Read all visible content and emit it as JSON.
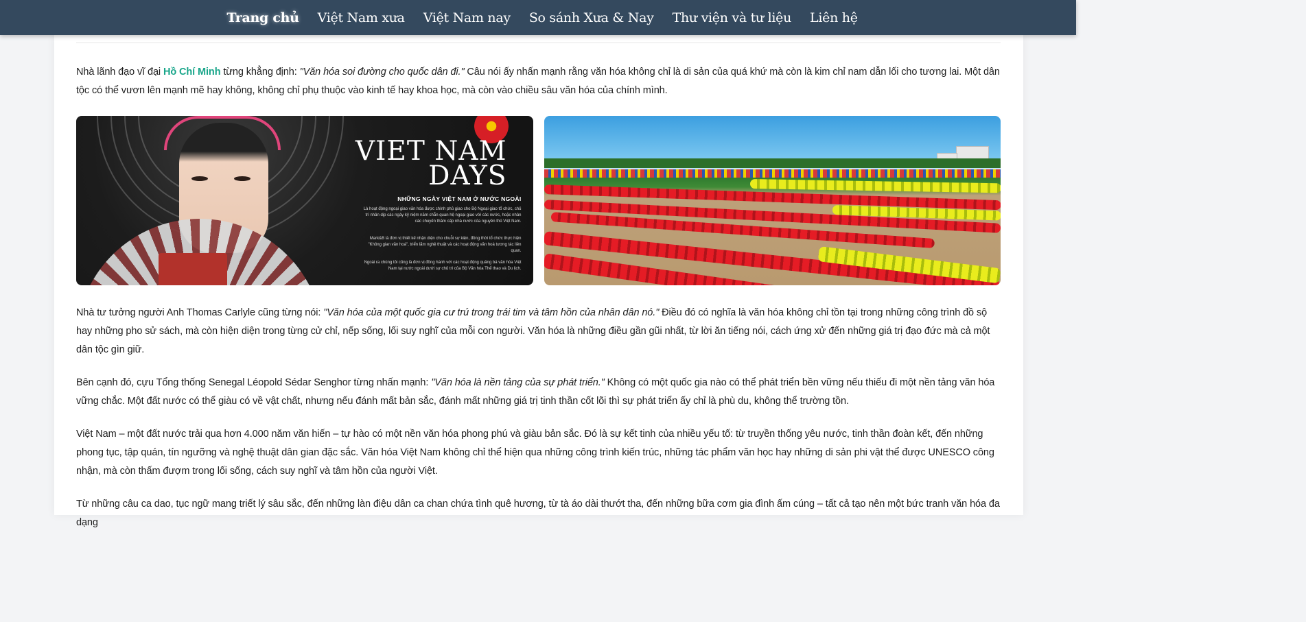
{
  "nav": {
    "items": [
      {
        "label": "Trang chủ",
        "active": true
      },
      {
        "label": "Việt Nam xưa",
        "active": false
      },
      {
        "label": "Việt Nam nay",
        "active": false
      },
      {
        "label": "So sánh Xưa & Nay",
        "active": false
      },
      {
        "label": "Thư viện và tư liệu",
        "active": false
      },
      {
        "label": "Liên hệ",
        "active": false
      }
    ],
    "background": "#34495e"
  },
  "colors": {
    "highlight": "#17a589",
    "text": "#1d1d1d"
  },
  "content": {
    "p1": {
      "before": "Nhà lãnh đạo vĩ đại ",
      "name": "Hồ Chí Minh",
      "middle": " từng khẳng định: ",
      "quote": "\"Văn hóa soi đường cho quốc dân đi.\"",
      "after": " Câu nói ấy nhấn mạnh rằng văn hóa không chỉ là di sản của quá khứ mà còn là kim chỉ nam dẫn lối cho tương lai. Một dân tộc có thể vươn lên mạnh mẽ hay không, không chỉ phụ thuộc vào kinh tế hay khoa học, mà còn vào chiều sâu văn hóa của chính mình."
    },
    "images": {
      "left": {
        "title_line1": "VIET NAM",
        "title_line2": "DAYS",
        "subtitle": "NHỮNG NGÀY VIỆT NAM Ở NƯỚC NGOÀI",
        "text1": "Là hoạt động ngoại giao văn hóa được chính phủ giao cho Bộ Ngoại giao tổ chức, chủ trì nhân dịp các ngày kỷ niệm năm chẵn quan hệ ngoại giao với các nước, hoặc nhân các chuyến thăm cấp nhà nước của nguyên thủ Việt Nam.",
        "text2": "Mark&B là đơn vị thiết kế nhận diện cho chuỗi sự kiện, đồng thời tổ chức thực hiện \"Không gian văn hoá\", triển lãm nghệ thuật và các hoạt động văn hoá tương tác liên quan.",
        "text3": "Ngoài ra chúng tôi cũng là đơn vị đồng hành với các hoạt động quảng bá văn hóa Việt Nam tại nước ngoài dưới sự chủ trì của Bộ Văn hóa Thể thao và Du lịch."
      }
    },
    "p2": {
      "before": "Nhà tư tưởng người Anh Thomas Carlyle cũng từng nói: ",
      "quote": "\"Văn hóa của một quốc gia cư trú trong trái tim và tâm hồn của nhân dân nó.\"",
      "after": " Điều đó có nghĩa là văn hóa không chỉ tồn tại trong những công trình đồ sộ hay những pho sử sách, mà còn hiện diện trong từng cử chỉ, nếp sống, lối suy nghĩ của mỗi con người. Văn hóa là những điều gần gũi nhất, từ lời ăn tiếng nói, cách ứng xử đến những giá trị đạo đức mà cả một dân tộc gìn giữ."
    },
    "p3": {
      "before": "Bên cạnh đó, cựu Tổng thống Senegal Léopold Sédar Senghor từng nhấn mạnh: ",
      "quote": "\"Văn hóa là nền tảng của sự phát triển.\"",
      "after": " Không có một quốc gia nào có thể phát triển bền vững nếu thiếu đi một nền tảng văn hóa vững chắc. Một đất nước có thể giàu có về vật chất, nhưng nếu đánh mất bản sắc, đánh mất những giá trị tinh thần cốt lõi thì sự phát triển ấy chỉ là phù du, không thể trường tồn."
    },
    "p4": "Việt Nam – một đất nước trải qua hơn 4.000 năm văn hiến – tự hào có một nền văn hóa phong phú và giàu bản sắc. Đó là sự kết tinh của nhiều yếu tố: từ truyền thống yêu nước, tinh thần đoàn kết, đến những phong tục, tập quán, tín ngưỡng và nghệ thuật dân gian đặc sắc. Văn hóa Việt Nam không chỉ thể hiện qua những công trình kiến trúc, những tác phẩm văn học hay những di sản phi vật thể được UNESCO công nhận, mà còn thấm đượm trong lối sống, cách suy nghĩ và tâm hồn của người Việt.",
    "p5": "Từ những câu ca dao, tục ngữ mang triết lý sâu sắc, đến những làn điệu dân ca chan chứa tình quê hương, từ tà áo dài thướt tha, đến những bữa cơm gia đình ấm cúng – tất cả tạo nên một bức tranh văn hóa đa dạng"
  }
}
